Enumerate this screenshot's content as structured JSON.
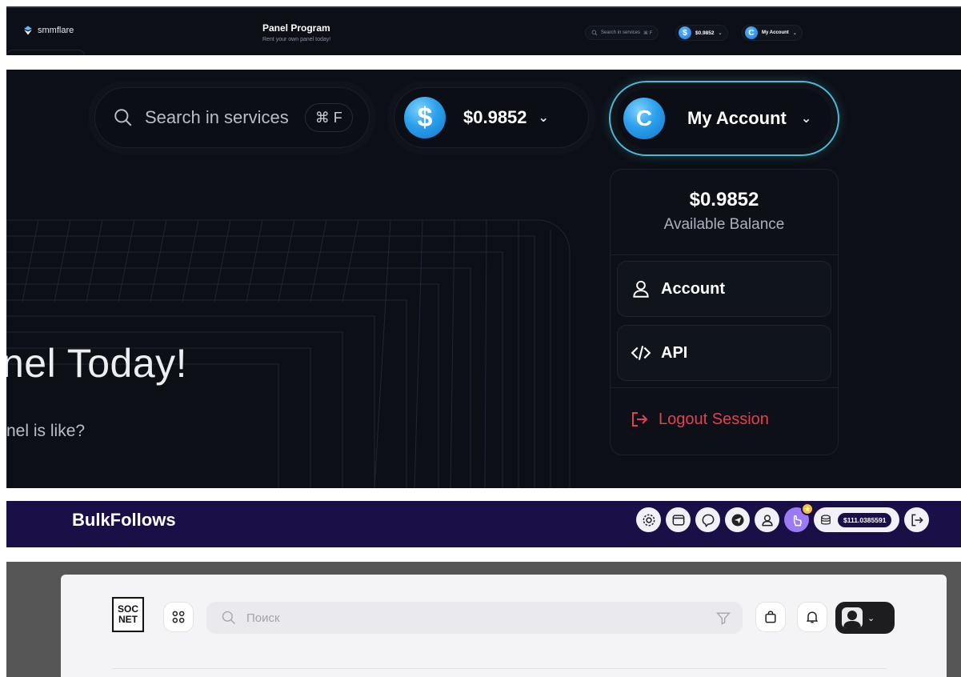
{
  "panel_smmflare": {
    "logo_text": "smmflare",
    "title": "Panel Program",
    "subtitle": "Rent your own panel today!",
    "search_placeholder": "Search in services",
    "shortcut": "⌘ F",
    "balance": "$0.9852",
    "coin_symbol": "$",
    "avatar_letter": "C",
    "account_label": "My Account"
  },
  "panel_dropdown": {
    "search_placeholder": "Search in services",
    "shortcut": "⌘ F",
    "coin_symbol": "$",
    "balance": "$0.9852",
    "avatar_letter": "C",
    "account_label": "My Account",
    "hero_title": "nel Today!",
    "hero_desc": "nel is like?",
    "menu": {
      "balance": "$0.9852",
      "balance_label": "Available Balance",
      "items": [
        {
          "label": "Account",
          "icon": "user-icon"
        },
        {
          "label": "API",
          "icon": "code-icon"
        }
      ],
      "logout_label": "Logout Session"
    }
  },
  "panel_bulkfollows": {
    "brand": "BulkFollows",
    "balance": "$111.0385591",
    "icons": [
      "settings-icon",
      "wallet-icon",
      "support-icon",
      "telegram-icon",
      "user-icon",
      "hand-pointer-icon",
      "coins-icon",
      "logout-icon"
    ]
  },
  "panel_socnet": {
    "logo_top": "SOC",
    "logo_bottom": "NET",
    "search_placeholder": "Поиск"
  },
  "colors": {
    "dark_bg": "#0c0f15",
    "accent_blue": "#2aa0ec",
    "account_ring": "#4bb8d4",
    "logout_red": "#e0424f",
    "bulk_bg": "#1b0f47",
    "bulk_active": "#9b7bf3"
  }
}
